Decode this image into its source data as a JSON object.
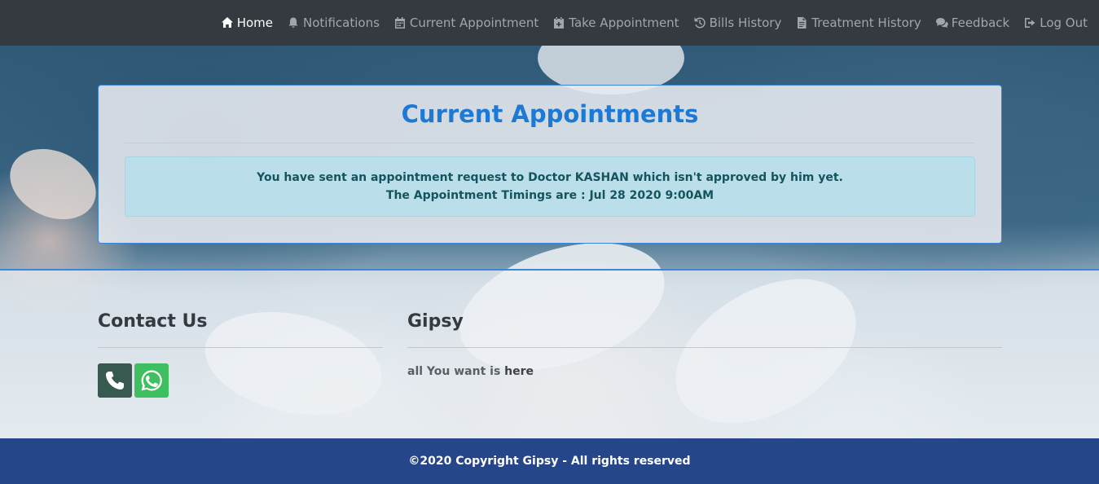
{
  "nav": {
    "items": [
      {
        "label": "Home",
        "icon": "home-icon",
        "active": true
      },
      {
        "label": "Notifications",
        "icon": "bell-icon"
      },
      {
        "label": "Current Appointment",
        "icon": "calendar-icon"
      },
      {
        "label": "Take Appointment",
        "icon": "calendar-plus-icon"
      },
      {
        "label": "Bills History",
        "icon": "history-icon"
      },
      {
        "label": "Treatment History",
        "icon": "file-icon"
      },
      {
        "label": "Feedback",
        "icon": "comments-icon"
      },
      {
        "label": "Log Out",
        "icon": "sign-out-icon"
      }
    ]
  },
  "card": {
    "title": "Current Appointments",
    "alert_line1": "You have sent an appointment request to Doctor KASHAN which isn't approved by him yet.",
    "alert_line2": "The Appointment Timings are : Jul 28 2020 9:00AM"
  },
  "footer": {
    "contact_title": "Contact Us",
    "brand_title": "Gipsy",
    "tagline_start": "all You want is ",
    "tagline_emphasis": "here"
  },
  "copyright": "©2020 Copyright Gipsy - All rights reserved",
  "colors": {
    "navbar": "#343a40",
    "title_blue": "#1c79d6",
    "alert_text": "#14545e",
    "copyright_bar": "#26468a",
    "whatsapp": "#3fbf5f"
  }
}
